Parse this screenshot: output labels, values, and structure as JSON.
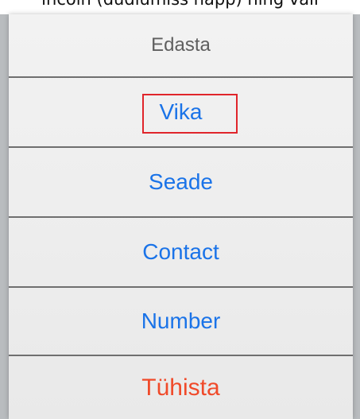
{
  "caption": "incoin (dudiumiss napp) ning vali",
  "sheet": {
    "title": "Edasta",
    "options": [
      "Vika",
      "Seade",
      "Contact",
      "Number"
    ],
    "cancel": "Tühista"
  },
  "colors": {
    "option_text": "#1a73e8",
    "cancel_text": "#f04a2a",
    "title_text": "#5f5f5f",
    "highlight_border": "#e0252b"
  }
}
